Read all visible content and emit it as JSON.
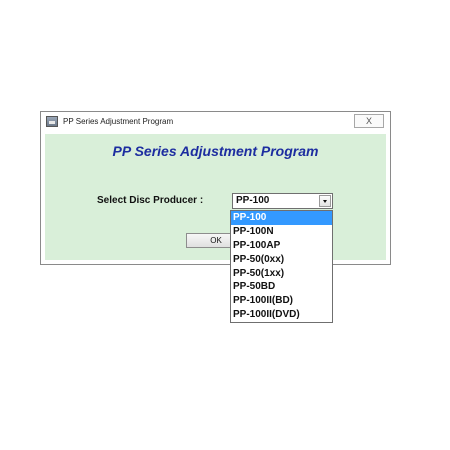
{
  "window": {
    "title": "PP Series Adjustment Program",
    "close_label": "X"
  },
  "main": {
    "heading": "PP Series Adjustment Program",
    "select_label": "Select Disc Producer :",
    "selected_value": "PP-100",
    "ok_label": "OK"
  },
  "dropdown": {
    "options": [
      "PP-100",
      "PP-100N",
      "PP-100AP",
      "PP-50(0xx)",
      "PP-50(1xx)",
      "PP-50BD",
      "PP-100II(BD)",
      "PP-100II(DVD)"
    ],
    "highlighted_option": "PP-100"
  },
  "colors": {
    "client_background": "#d9efd9",
    "heading": "#1d2da0",
    "highlight": "#3399ff"
  }
}
